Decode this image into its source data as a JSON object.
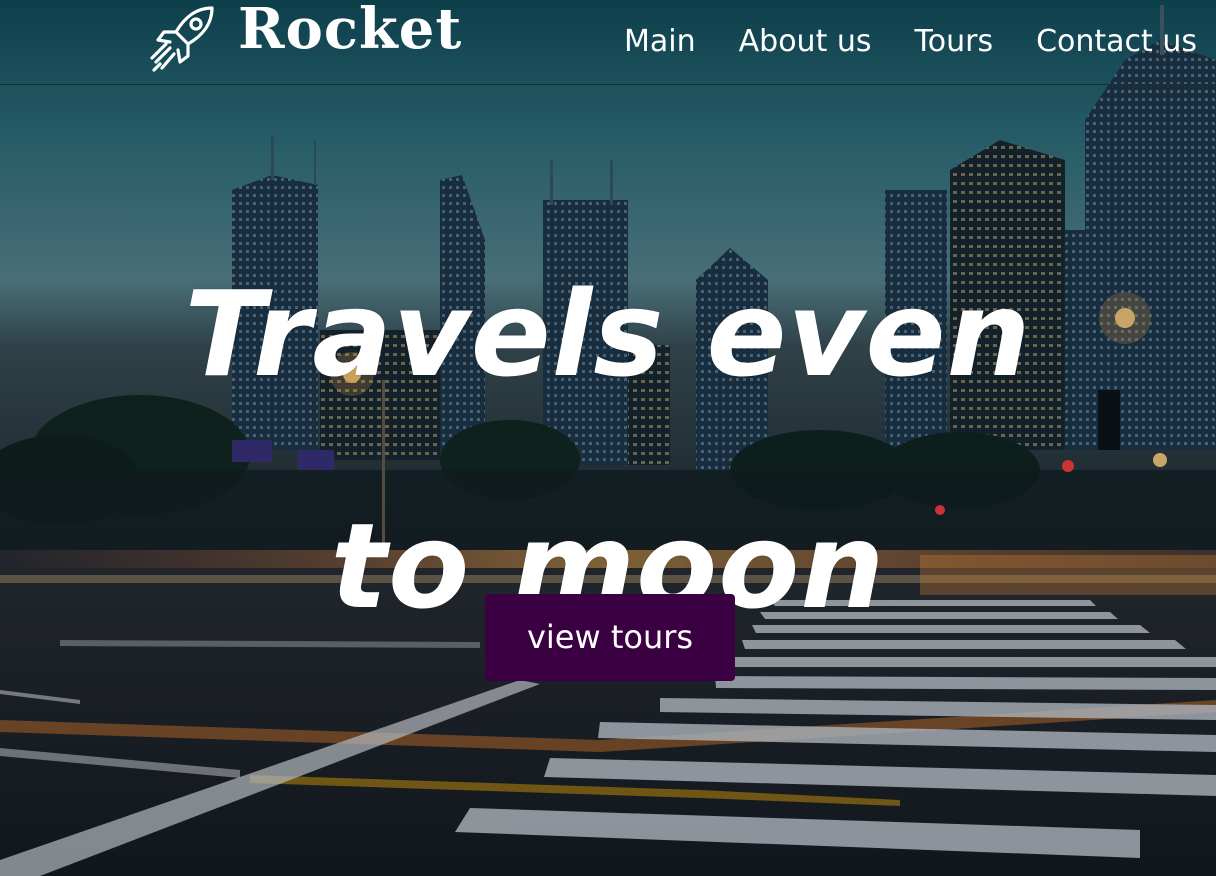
{
  "header": {
    "logo_text": "Rocket",
    "logo_icon": "rocket-icon",
    "nav": [
      {
        "label": "Main"
      },
      {
        "label": "About us"
      },
      {
        "label": "Tours"
      },
      {
        "label": "Contact us"
      }
    ]
  },
  "hero": {
    "title": "Travels even to moon",
    "cta_label": "view tours",
    "background": "city-night-crosswalk-photo"
  },
  "colors": {
    "cta_background": "#3b0041",
    "text": "#ffffff",
    "overlay": "#0b1a24"
  }
}
